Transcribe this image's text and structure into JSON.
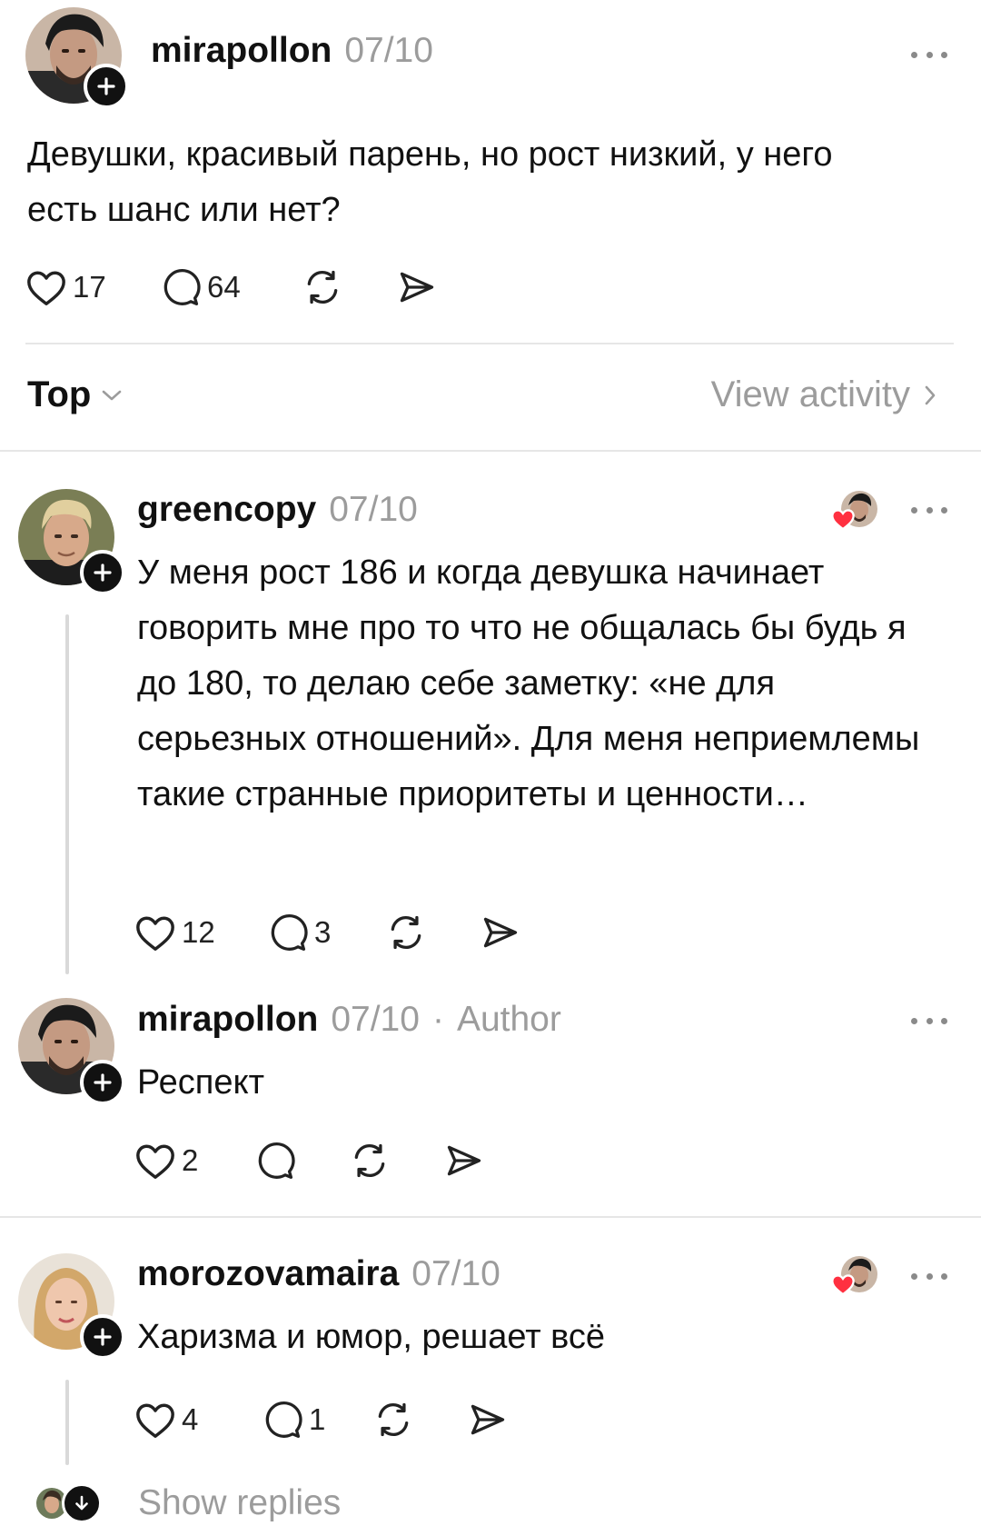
{
  "post": {
    "username": "mirapollon",
    "date": "07/10",
    "text": "Девушки, красивый парень, но рост низкий, у него есть шанс или нет?",
    "likes": "17",
    "replies": "64"
  },
  "sort_bar": {
    "sort_label": "Top",
    "activity_label": "View activity"
  },
  "comments": [
    {
      "username": "greencopy",
      "date": "07/10",
      "text": "У меня рост 186 и когда девушка начинает говорить мне про то что не общалась бы будь я до 180, то делаю себе заметку: «не для серьезных отношений». Для меня неприемлемы такие странные приоритеты и ценности…",
      "likes": "12",
      "replies": "3"
    },
    {
      "username": "mirapollon",
      "date": "07/10",
      "author_tag": "Author",
      "text": "Респект",
      "likes": "2",
      "replies": ""
    },
    {
      "username": "morozovamaira",
      "date": "07/10",
      "text": "Харизма и юмор, решает всё",
      "likes": "4",
      "replies": "1"
    }
  ],
  "show_replies_label": "Show replies",
  "colors": {
    "text": "#111111",
    "muted": "#9c9c9c",
    "like_heart": "#ff3040",
    "divider": "#e6e6e6"
  },
  "icons": [
    "plus-icon",
    "heart-icon",
    "comment-icon",
    "repost-icon",
    "share-icon",
    "more-icon",
    "chevron-down-icon",
    "chevron-right-icon",
    "arrow-down-icon"
  ]
}
